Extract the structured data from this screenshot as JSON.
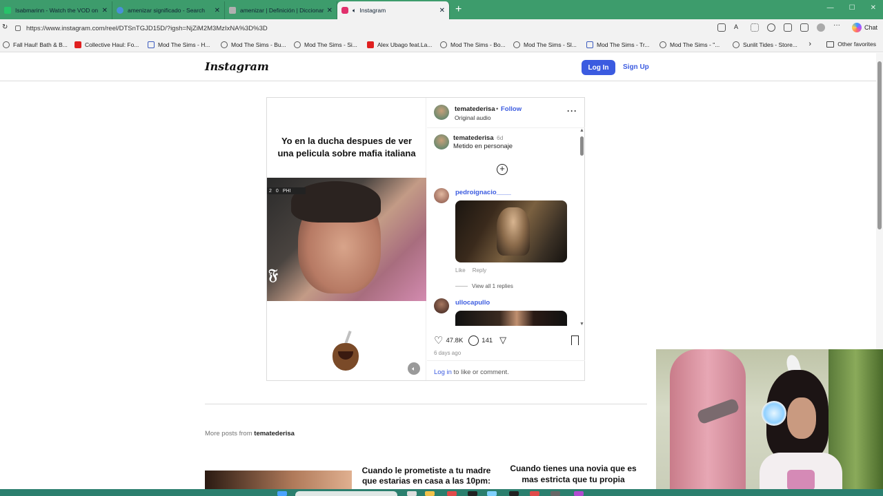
{
  "browser": {
    "tabs": [
      {
        "title": "Isabmarinn - Watch the VOD on Ki",
        "color": "#27c36a"
      },
      {
        "title": "amenizar significado - Search",
        "color": "#4a90d9"
      },
      {
        "title": "amenizar | Definición | Diccionario",
        "color": "#b0b0b0"
      },
      {
        "title": "Instagram",
        "color": "#e1306c"
      }
    ],
    "new_tab": "+",
    "url": "https://www.instagram.com/reel/DTSnTGJD15D/?igsh=NjZiM2M3MzIxNA%3D%3D",
    "chat_label": "Chat",
    "favorites": [
      {
        "label": "Fall Haul! Bath & B...",
        "icon": "globe-icon"
      },
      {
        "label": "Collective Haul: Fo...",
        "icon": "youtube-icon"
      },
      {
        "label": "Mod The Sims - H...",
        "icon": "doc-icon"
      },
      {
        "label": "Mod The Sims - Bu...",
        "icon": "globe-icon"
      },
      {
        "label": "Mod The Sims - Si...",
        "icon": "globe-icon"
      },
      {
        "label": "Alex Ubago feat.La...",
        "icon": "youtube-icon"
      },
      {
        "label": "Mod The Sims - Bo...",
        "icon": "globe-icon"
      },
      {
        "label": "Mod The Sims - Sl...",
        "icon": "globe-icon"
      },
      {
        "label": "Mod The Sims - Tr...",
        "icon": "doc-icon"
      },
      {
        "label": "Mod The Sims - \"...",
        "icon": "globe-icon"
      },
      {
        "label": "Sunlit Tides - Store...",
        "icon": "globe-icon"
      }
    ],
    "other_favorites": "Other favorites"
  },
  "instagram": {
    "logo": "Instagram",
    "login_label": "Log In",
    "signup_label": "Sign Up",
    "post": {
      "caption": "Yo en la ducha despues de ver una pelicula sobre mafia italiana",
      "scorebug": [
        "2",
        "0",
        "PHI"
      ],
      "owner": "tematederisa",
      "follow_label": "Follow",
      "dot": "•",
      "audio": "Original audio",
      "caption_user": "tematederisa",
      "caption_time": "6d",
      "caption_text": "Metido en personaje",
      "comments": [
        {
          "user": "pedroignacio____",
          "like": "Like",
          "reply": "Reply",
          "view_replies": "View all 1 replies"
        },
        {
          "user": "ullocapullo"
        }
      ],
      "likes": "47.8K",
      "comments_count": "141",
      "posted": "6 days ago",
      "login_link": "Log in",
      "login_rest": " to like or comment."
    },
    "more_posts_prefix": "More posts from ",
    "more_posts_user": "tematederisa",
    "thumb2_caption": "Cuando le prometiste a tu madre que estarias en casa a las 10pm:",
    "thumb3_caption": "Cuando tienes una novia que es mas estricta que tu propia"
  },
  "colors": {
    "accent": "#3b5be0",
    "tabbar": "#3d9c6c"
  }
}
